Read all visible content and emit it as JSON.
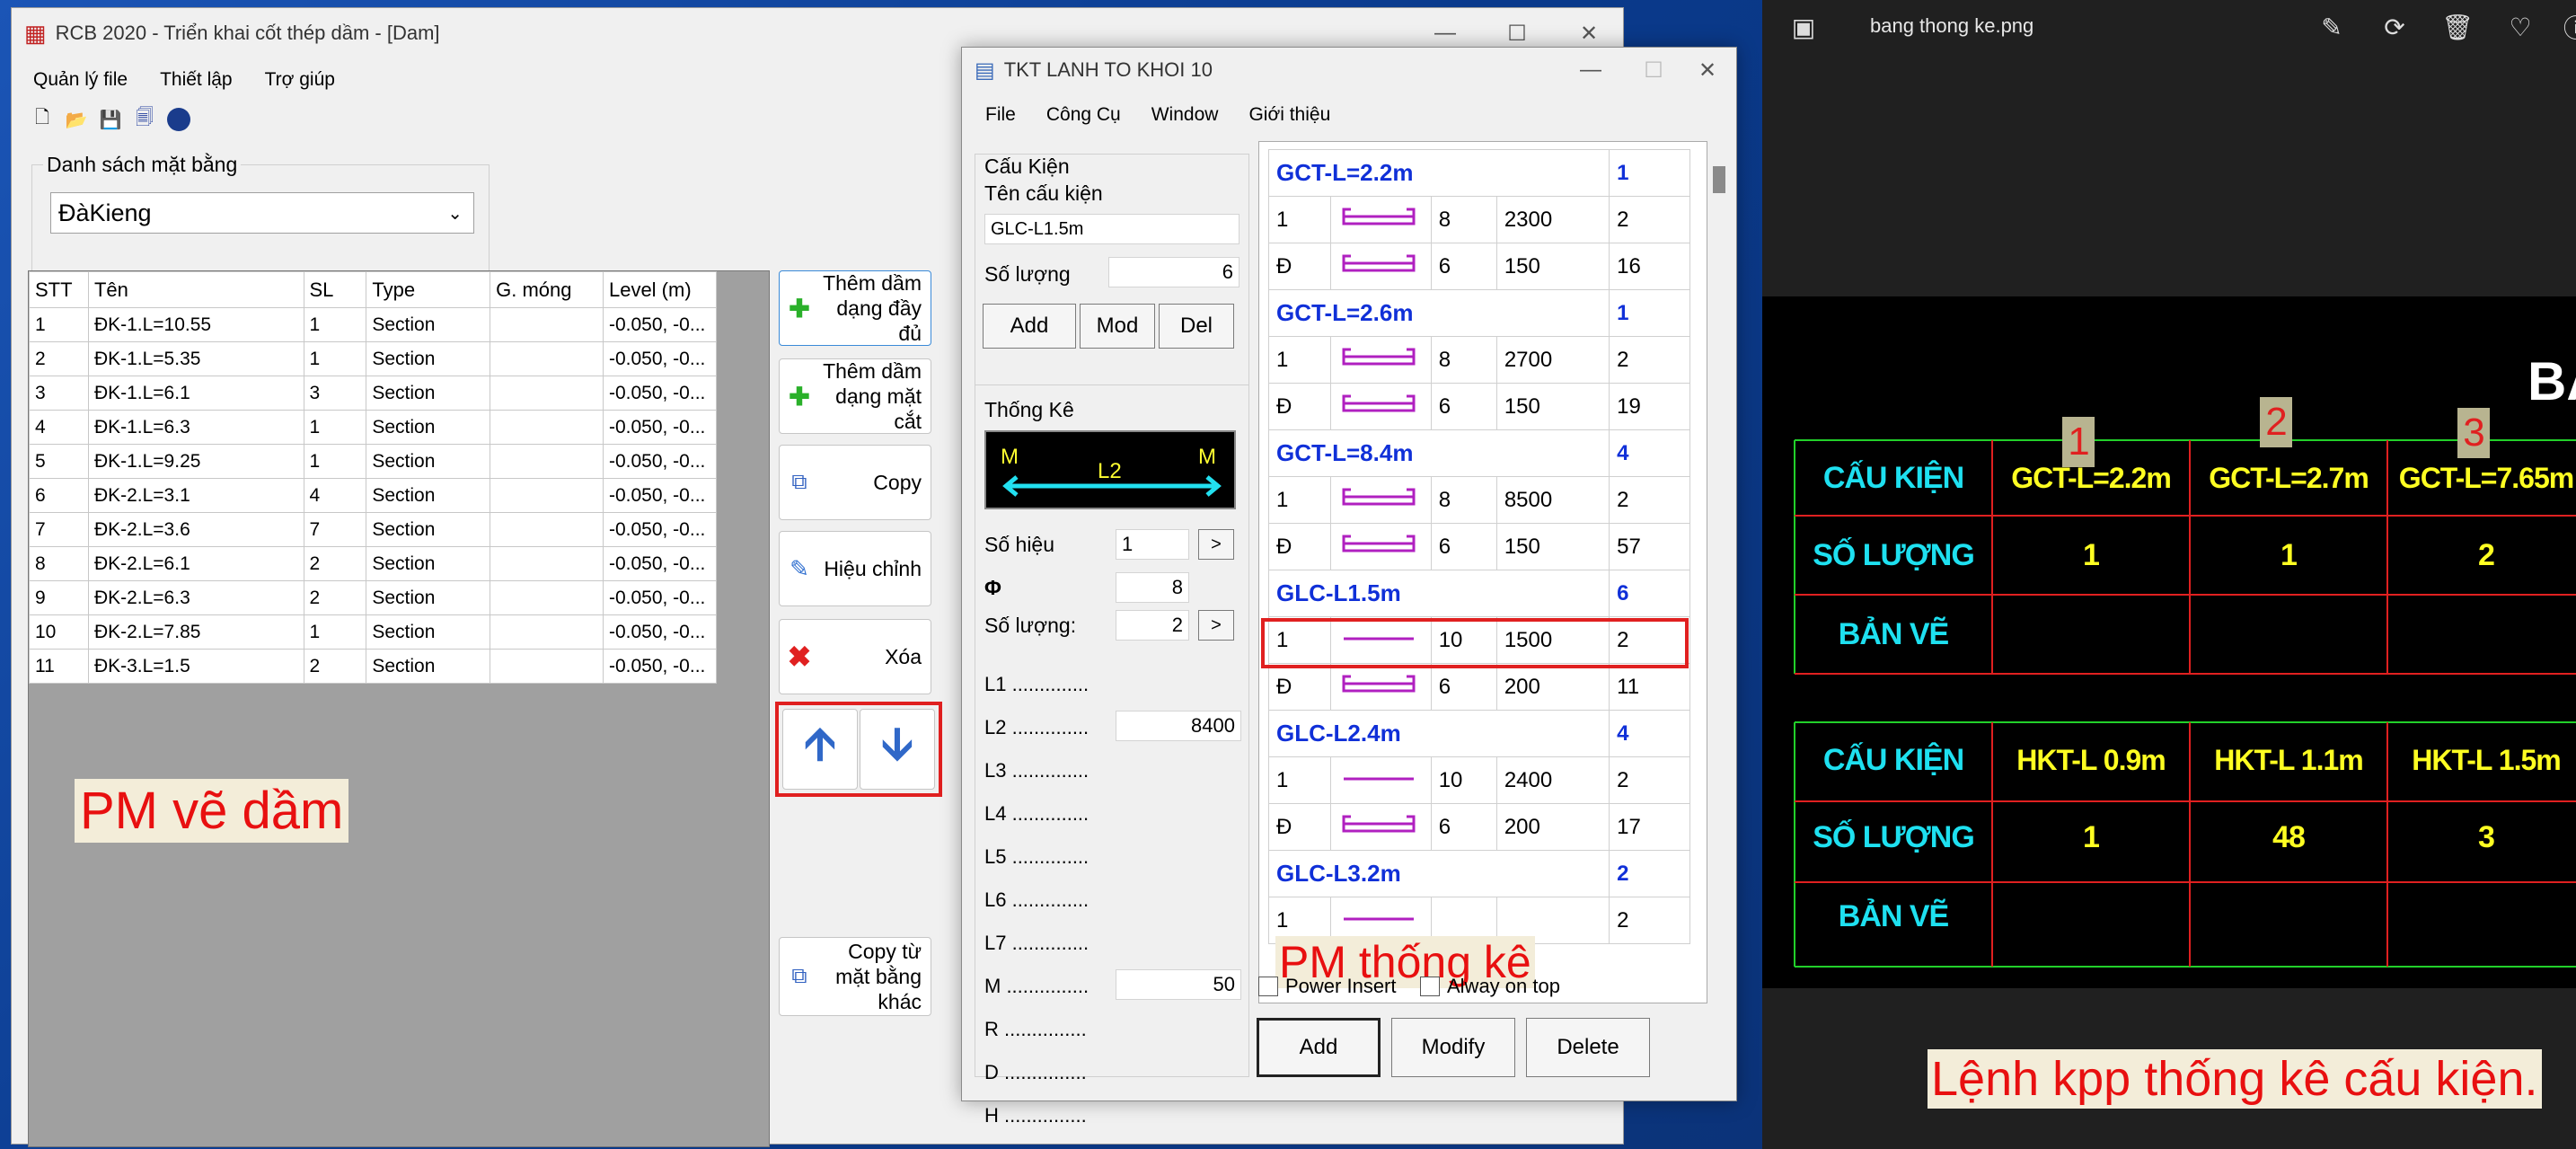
{
  "rcb": {
    "title": "RCB 2020 - Triển khai cốt thép dầm - [Dam]",
    "menu": [
      "Quản lý file",
      "Thiết lập",
      "Trợ giúp"
    ],
    "plan_list_label": "Danh sách mặt bằng",
    "plan_selected": "ĐàKieng",
    "table": {
      "headers": [
        "STT",
        "Tên",
        "SL",
        "Type",
        "G. móng",
        "Level (m)"
      ],
      "rows": [
        [
          "1",
          "ĐK-1.L=10.55",
          "1",
          "Section",
          "",
          "-0.050, -0..."
        ],
        [
          "2",
          "ĐK-1.L=5.35",
          "1",
          "Section",
          "",
          "-0.050, -0..."
        ],
        [
          "3",
          "ĐK-1.L=6.1",
          "3",
          "Section",
          "",
          "-0.050, -0..."
        ],
        [
          "4",
          "ĐK-1.L=6.3",
          "1",
          "Section",
          "",
          "-0.050, -0..."
        ],
        [
          "5",
          "ĐK-1.L=9.25",
          "1",
          "Section",
          "",
          "-0.050, -0..."
        ],
        [
          "6",
          "ĐK-2.L=3.1",
          "4",
          "Section",
          "",
          "-0.050, -0..."
        ],
        [
          "7",
          "ĐK-2.L=3.6",
          "7",
          "Section",
          "",
          "-0.050, -0..."
        ],
        [
          "8",
          "ĐK-2.L=6.1",
          "2",
          "Section",
          "",
          "-0.050, -0..."
        ],
        [
          "9",
          "ĐK-2.L=6.3",
          "2",
          "Section",
          "",
          "-0.050, -0..."
        ],
        [
          "10",
          "ĐK-2.L=7.85",
          "1",
          "Section",
          "",
          "-0.050, -0..."
        ],
        [
          "11",
          "ĐK-3.L=1.5",
          "2",
          "Section",
          "",
          "-0.050, -0..."
        ]
      ]
    },
    "buttons": {
      "add_full": "Thêm dầm dạng đầy đủ",
      "add_section": "Thêm dầm dạng mặt cắt",
      "copy": "Copy",
      "edit": "Hiệu chỉnh",
      "delete": "Xóa",
      "copy_other": "Copy từ mặt bằng khác"
    },
    "annotation": "PM vẽ dầm"
  },
  "tkt": {
    "title": "TKT LANH TO KHOI 10",
    "menu": [
      "File",
      "Công Cụ",
      "Window",
      "Giới thiệu"
    ],
    "cau_kien_group": "Cấu Kiện",
    "ten_label": "Tên cấu kiện",
    "ten_value": "GLC-L1.5m",
    "so_luong_label": "Số lượng",
    "so_luong_value": "6",
    "btn_add": "Add",
    "btn_mod": "Mod",
    "btn_del": "Del",
    "thong_ke_group": "Thống Kê",
    "preview": {
      "m_left": "M",
      "l2": "L2",
      "m_right": "M"
    },
    "so_hieu_label": "Số hiệu",
    "so_hieu_value": "1",
    "phi_label": "Φ",
    "phi_value": "8",
    "so_luong2_label": "Số lượng:",
    "so_luong2_value": "2",
    "arrow": ">",
    "dims": [
      {
        "label": "L1 ..............",
        "value": ""
      },
      {
        "label": "L2 ..............",
        "value": "8400"
      },
      {
        "label": "L3 ..............",
        "value": ""
      },
      {
        "label": "L4 ..............",
        "value": ""
      },
      {
        "label": "L5 ..............",
        "value": ""
      },
      {
        "label": "L6 ..............",
        "value": ""
      },
      {
        "label": "L7 ..............",
        "value": ""
      },
      {
        "label": "M ...............",
        "value": "50"
      },
      {
        "label": "R ...............",
        "value": ""
      },
      {
        "label": "D ...............",
        "value": ""
      },
      {
        "label": "H ...............",
        "value": ""
      }
    ],
    "stats": [
      {
        "name": "GCT-L=2.2m",
        "count": "1",
        "rows": [
          [
            "1",
            "8",
            "2300",
            "2"
          ],
          [
            "Đ",
            "6",
            "150",
            "16"
          ]
        ]
      },
      {
        "name": "GCT-L=2.6m",
        "count": "1",
        "rows": [
          [
            "1",
            "8",
            "2700",
            "2"
          ],
          [
            "Đ",
            "6",
            "150",
            "19"
          ]
        ]
      },
      {
        "name": "GCT-L=8.4m",
        "count": "4",
        "rows": [
          [
            "1",
            "8",
            "8500",
            "2"
          ],
          [
            "Đ",
            "6",
            "150",
            "57"
          ]
        ]
      },
      {
        "name": "GLC-L1.5m",
        "count": "6",
        "rows": [
          [
            "1",
            "10",
            "1500",
            "2"
          ],
          [
            "Đ",
            "6",
            "200",
            "11"
          ]
        ]
      },
      {
        "name": "GLC-L2.4m",
        "count": "4",
        "rows": [
          [
            "1",
            "10",
            "2400",
            "2"
          ],
          [
            "Đ",
            "6",
            "200",
            "17"
          ]
        ]
      },
      {
        "name": "GLC-L3.2m",
        "count": "2",
        "rows": [
          [
            "1",
            "",
            "",
            "2"
          ]
        ]
      }
    ],
    "power_insert": "Power Insert",
    "always_on_top": "Alway on top",
    "bottom_add": "Add",
    "bottom_modify": "Modify",
    "bottom_delete": "Delete",
    "annotation": "PM thống kê"
  },
  "viewer": {
    "filename": "bang thong ke.png",
    "cad": {
      "partial_title": "BẢ",
      "col_numbers": [
        "1",
        "2",
        "3"
      ],
      "table1": {
        "row_labels": [
          "CẤU KIỆN",
          "SỐ LƯỢNG",
          "BẢN VẼ"
        ],
        "names": [
          "GCT-L=2.2m",
          "GCT-L=2.7m",
          "GCT-L=7.65m"
        ],
        "counts": [
          "1",
          "1",
          "2"
        ]
      },
      "table2": {
        "row_labels": [
          "CẤU KIỆN",
          "SỐ LƯỢNG",
          "BẢN VẼ"
        ],
        "names": [
          "HKT-L 0.9m",
          "HKT-L 1.1m",
          "HKT-L 1.5m"
        ],
        "counts": [
          "1",
          "48",
          "3"
        ]
      }
    },
    "annotation": "Lệnh kpp thống kê cấu kiện."
  },
  "colors": {
    "annotation_red": "#e81010",
    "highlight_red": "#e02020",
    "stat_blue": "#1030d8",
    "cad_cyan": "#1ee0f0",
    "cad_yellow": "#ffff22"
  }
}
